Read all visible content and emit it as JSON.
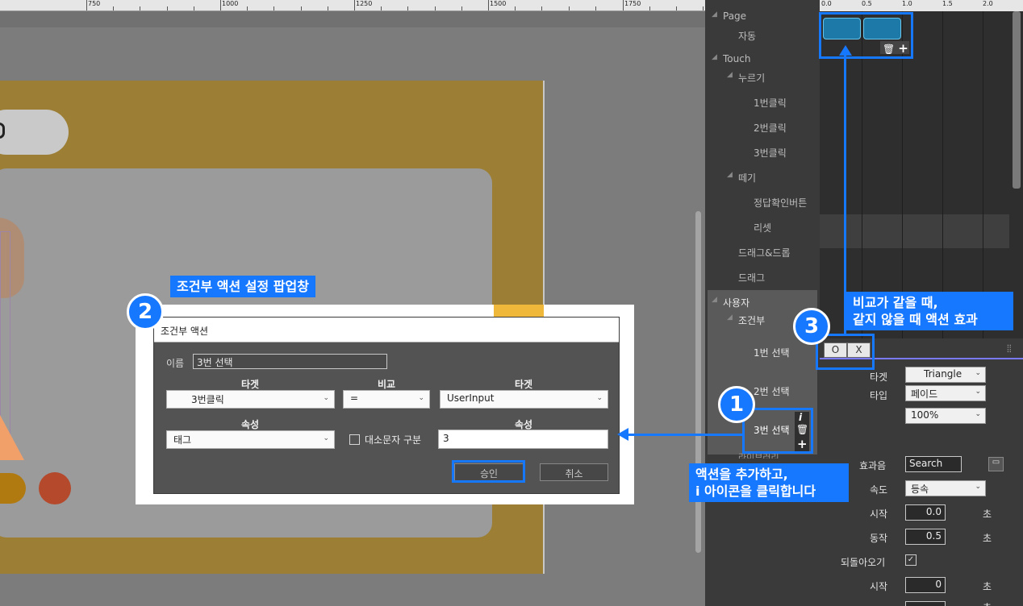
{
  "ruler": {
    "ticks": [
      "750",
      "1000",
      "1250",
      "1500",
      "1750"
    ]
  },
  "popup": {
    "title": "조건부 액션",
    "name_label": "이름",
    "name_value": "3번 선택",
    "target_header_1": "타겟",
    "compare_header": "비교",
    "target_header_2": "타겟",
    "target_select_1": "3번클릭",
    "compare_select": "=",
    "target_select_2": "UserInput",
    "attr_header_1": "속성",
    "attr_header_2": "속성",
    "attr_select_1": "태그",
    "case_label": "대소문자 구분",
    "attr_value_2": "3",
    "approve_label": "승인",
    "cancel_label": "취소"
  },
  "annotations": {
    "badge_1": "1",
    "badge_2": "2",
    "badge_3": "3",
    "callout_2": "조건부 액션 설정 팝업창",
    "callout_1_line1": "액션을 추가하고,",
    "callout_1_line2": "i 아이콘을 클릭합니다",
    "callout_3_line1": "비교가 같을 때,",
    "callout_3_line2": "같지 않을 때 액션 효과"
  },
  "tree": {
    "page": "Page",
    "auto": "자동",
    "touch": "Touch",
    "press": "누르기",
    "click1": "1번클릭",
    "click2": "2번클릭",
    "click3": "3번클릭",
    "release": "떼기",
    "answer_btn": "정답확인버튼",
    "reset": "리셋",
    "dragdrop": "드래그&드롭",
    "drag": "드래그",
    "user": "사용자",
    "conditional": "조건부",
    "sel1": "1번 선택",
    "sel2": "2번 선택",
    "sel3": "3번 선택",
    "library_partial": "라이브러리"
  },
  "timeline": {
    "ticks": [
      "0.0",
      "0.5",
      "1.0",
      "1.5",
      "2.0"
    ],
    "o_label": "O",
    "x_label": "X"
  },
  "props": {
    "target_label": "타겟",
    "target_value": "Triangle",
    "type_label": "타입",
    "type_value": "페이드",
    "percent_value": "100%",
    "sound_label": "효과음",
    "sound_value": "Search",
    "speed_label": "속도",
    "speed_value": "등속",
    "start_label": "시작",
    "start_value": "0.0",
    "start_unit": "초",
    "action_label": "동작",
    "action_value": "0.5",
    "action_unit": "초",
    "return_label": "되돌아오기",
    "return_start_label": "시작",
    "return_start_value": "0",
    "return_start_unit": "초",
    "partial_unit": "초"
  },
  "colors": {
    "accent": "#1677ff",
    "card": "#9c7f35",
    "clip": "#1d7aa8"
  }
}
